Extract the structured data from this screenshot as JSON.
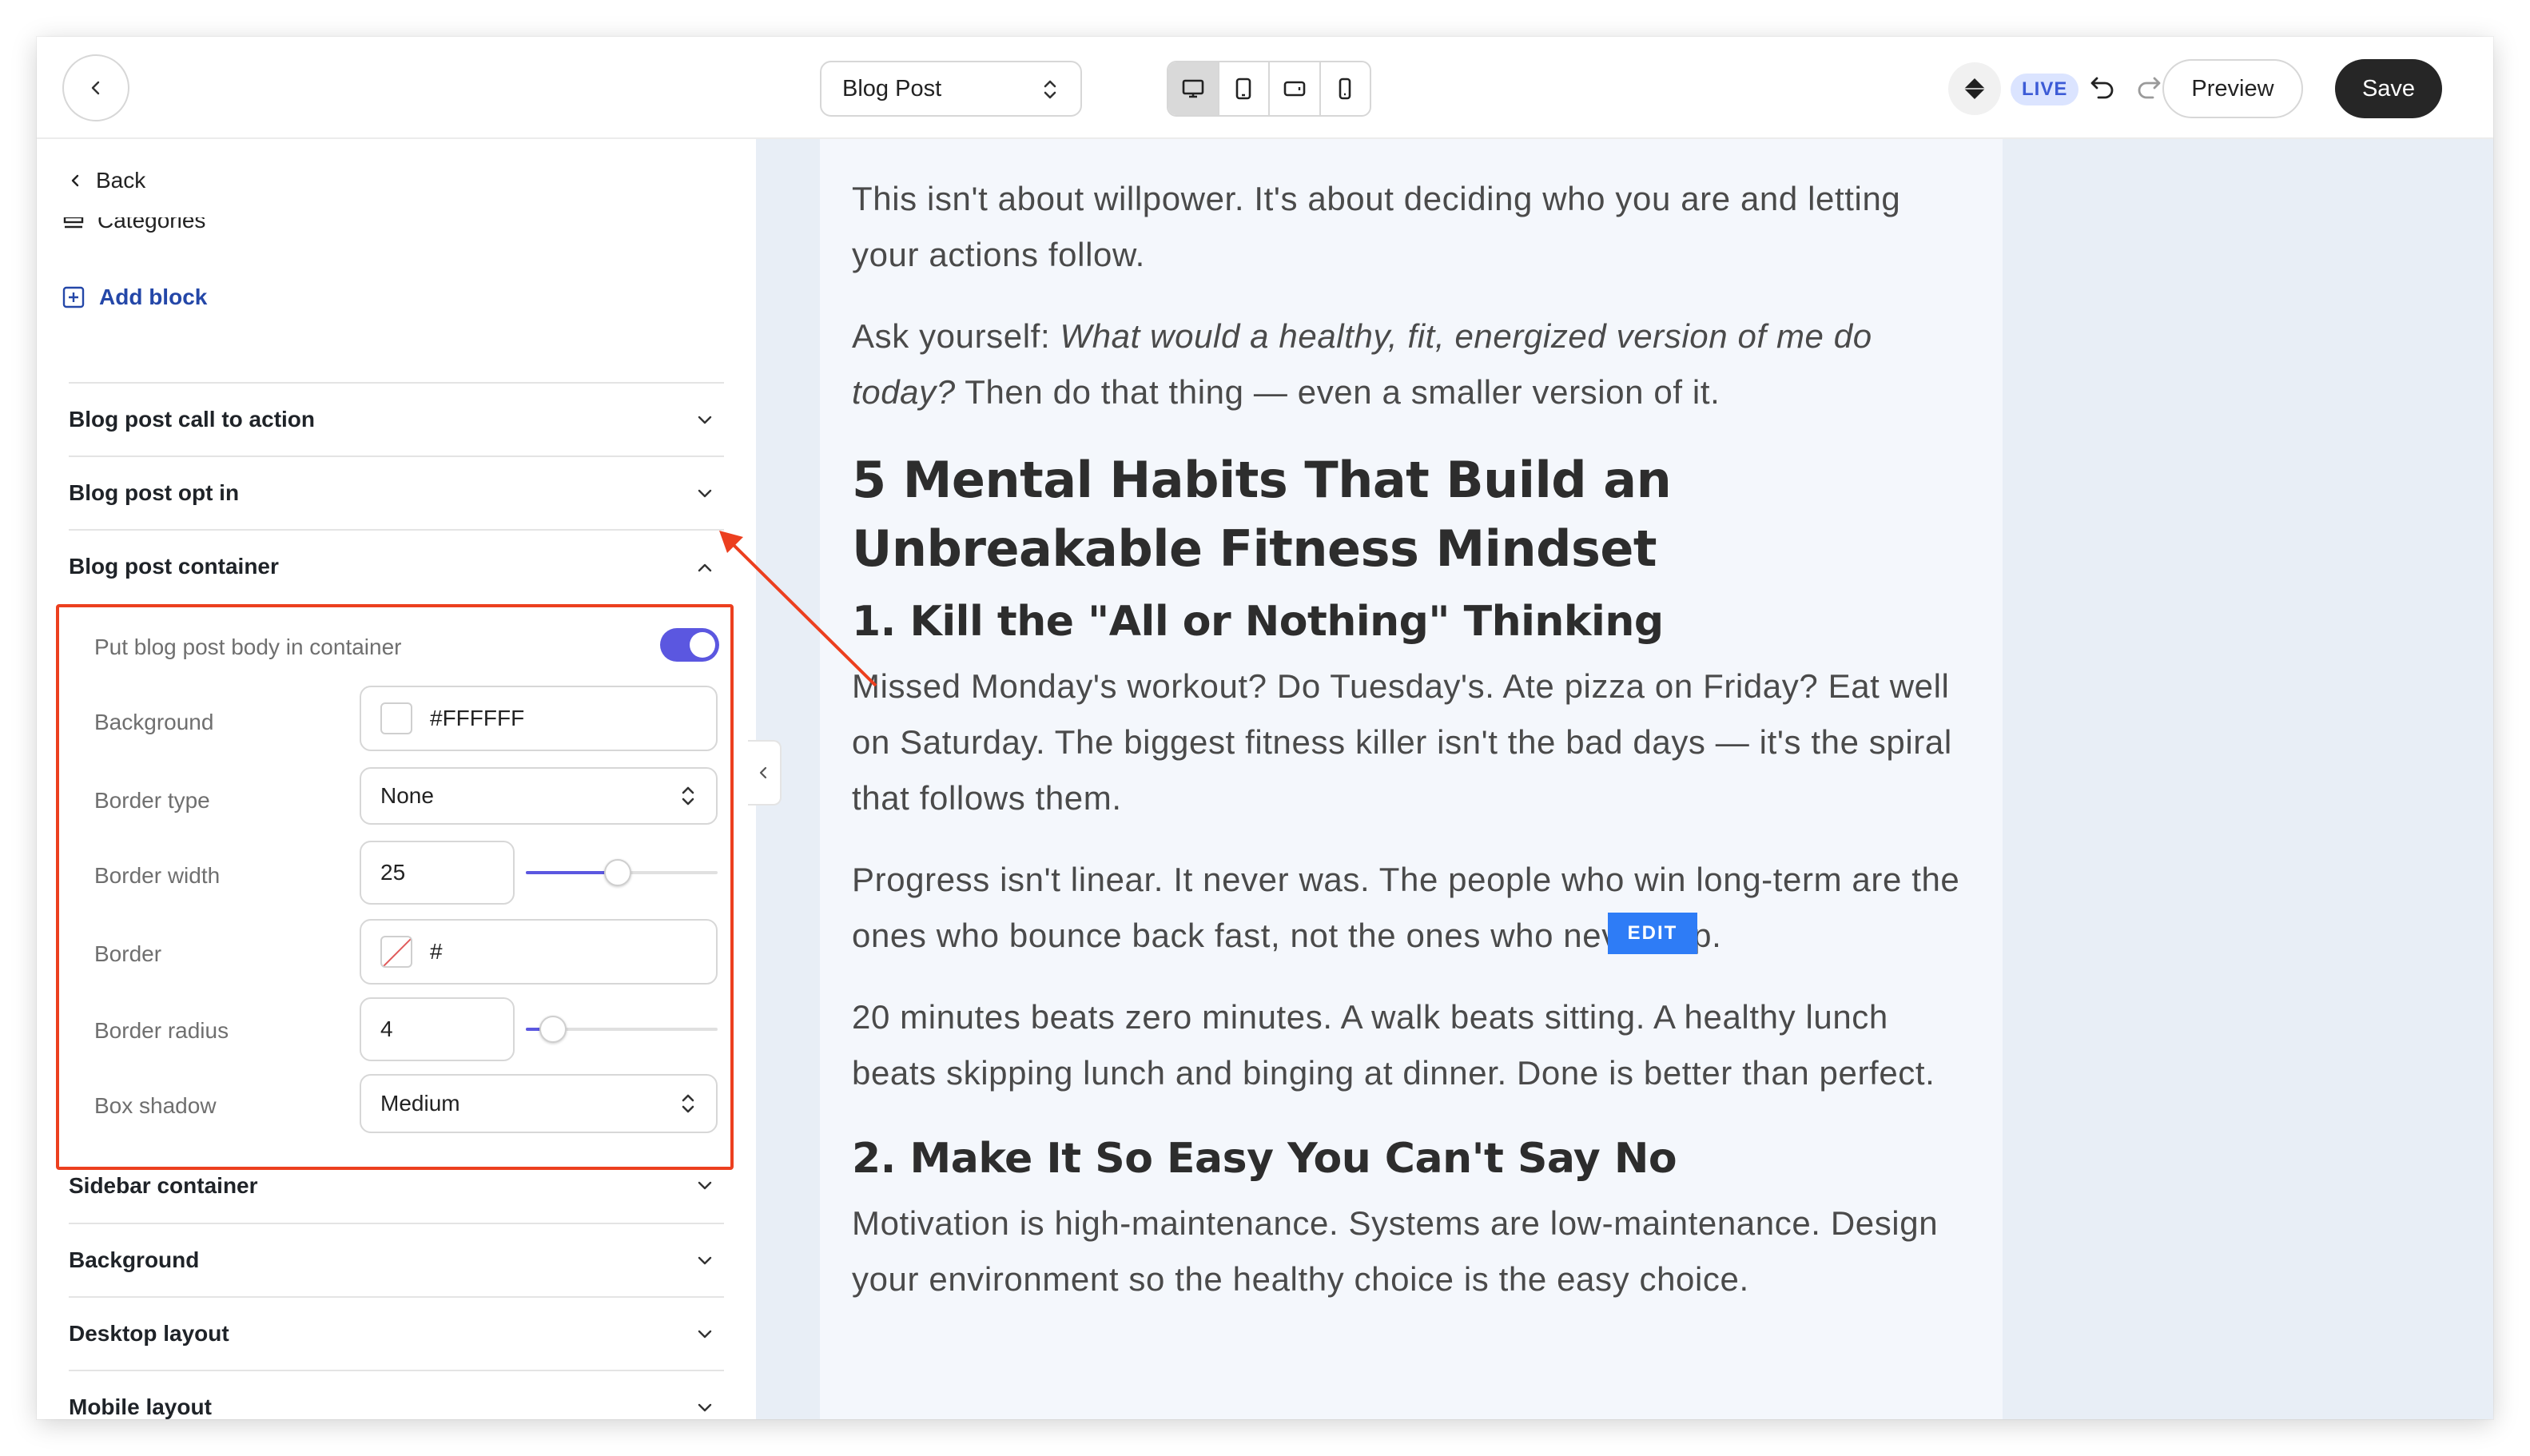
{
  "topbar": {
    "page_select_value": "Blog Post",
    "live_badge": "LIVE",
    "preview_label": "Preview",
    "save_label": "Save"
  },
  "sidebar": {
    "back_label": "Back",
    "categories_label": "Categories",
    "add_block_label": "Add block",
    "sections": {
      "call_to_action": "Blog post call to action",
      "opt_in": "Blog post opt in",
      "container": "Blog post container",
      "sidebar_container": "Sidebar container",
      "background": "Background",
      "desktop_layout": "Desktop layout",
      "mobile_layout": "Mobile layout"
    },
    "container_settings": {
      "toggle_label": "Put blog post body in container",
      "toggle_on": true,
      "background_label": "Background",
      "background_value": "#FFFFFF",
      "border_type_label": "Border type",
      "border_type_value": "None",
      "border_width_label": "Border width",
      "border_width_value": "25",
      "border_width_fraction": 0.48,
      "border_label": "Border",
      "border_value": "#",
      "border_radius_label": "Border radius",
      "border_radius_value": "4",
      "border_radius_fraction": 0.14,
      "box_shadow_label": "Box shadow",
      "box_shadow_value": "Medium"
    }
  },
  "article": {
    "p1": "This isn't about willpower. It's about deciding who you are and letting your actions follow.",
    "p2_start": "Ask yourself: ",
    "p2_em": "What would a healthy, fit, energized version of me do today?",
    "p2_end": " Then do that thing — even a smaller version of it.",
    "h2": "5 Mental Habits That Build an Unbreakable Fitness Mindset",
    "h3_1": "1. Kill the \"All or Nothing\" Thinking",
    "p3": "Missed Monday's workout? Do Tuesday's. Ate pizza on Friday? Eat well on Saturday. The biggest fitness killer isn't the bad days — it's the spiral that follows them.",
    "p4": "Progress isn't linear. It never was. The people who win long-term are the ones who bounce back fast, not the ones who never slip.",
    "p5": "20 minutes beats zero minutes. A walk beats sitting. A healthy lunch beats skipping lunch and binging at dinner. Done is better than perfect.",
    "h3_2": "2. Make It So Easy You Can't Say No",
    "p6": "Motivation is high-maintenance. Systems are low-maintenance. Design your environment so the healthy choice is the easy choice.",
    "edit_tag": "EDIT"
  },
  "colors": {
    "accent": "#5b57e0",
    "highlight": "#ec3f1f",
    "save_bg": "#262626",
    "live_bg": "#dbe4ff",
    "edit_bg": "#2e7cf6"
  }
}
